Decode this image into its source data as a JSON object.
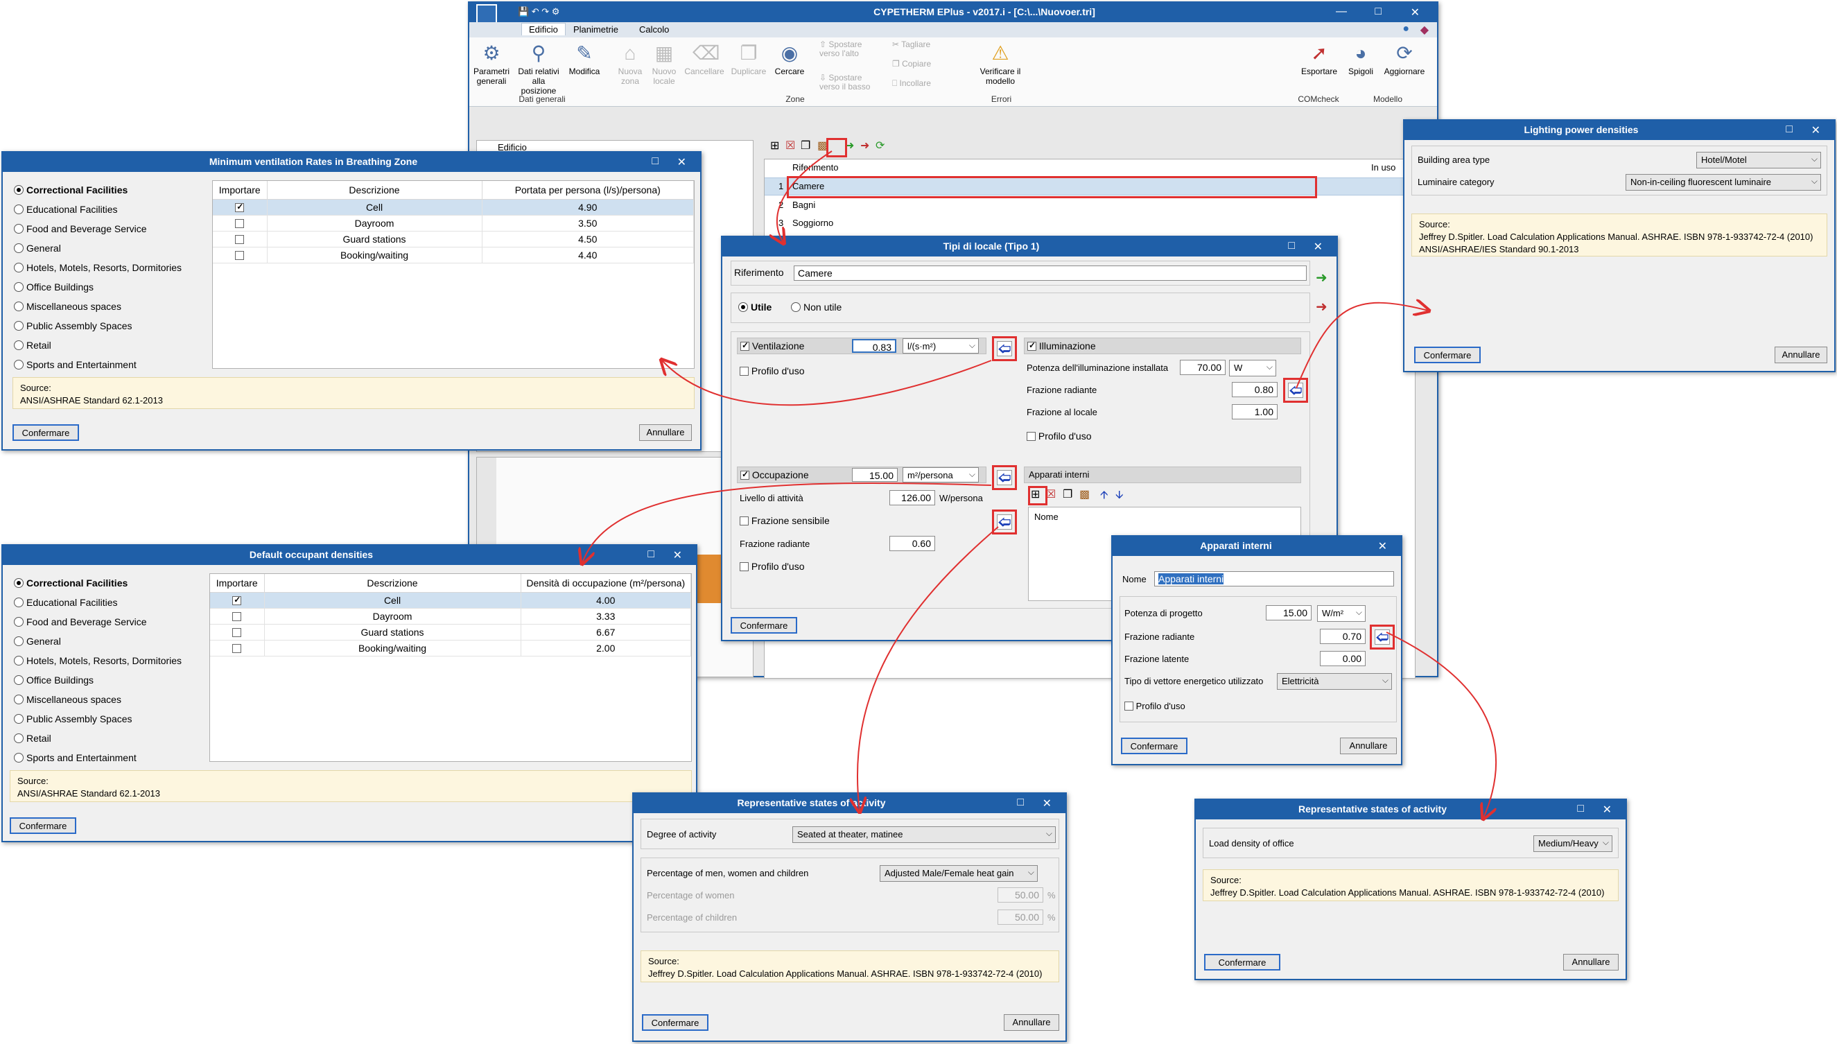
{
  "main_window": {
    "title": "CYPETHERM EPlus - v2017.i - [C:\\...\\Nuovoer.tri]",
    "tabs": [
      "Edificio",
      "Planimetrie",
      "Calcolo"
    ],
    "ribbon": {
      "parametri": "Parametri generali",
      "dati_relativi": "Dati relativi alla posizione",
      "modifica": "Modifica",
      "nuova_zona": "Nuova zona",
      "nuovo_locale": "Nuovo locale",
      "cancellare": "Cancellare",
      "duplicare": "Duplicare",
      "cercare": "Cercare",
      "spostare_alto": "Spostare verso l'alto",
      "spostare_basso": "Spostare verso il basso",
      "tagliare": "Tagliare",
      "copiare": "Copiare",
      "incollare": "Incollare",
      "verificare": "Verificare il modello",
      "esportare": "Esportare",
      "spigoli": "Spigoli",
      "aggiornare": "Aggiornare",
      "groups": [
        "Dati generali",
        "Zone",
        "Errori",
        "COMcheck",
        "Modello"
      ]
    },
    "tree_root": "Edificio",
    "list_headers": [
      "Riferimento",
      "In uso"
    ],
    "list_rows": [
      {
        "n": "1",
        "name": "Camere"
      },
      {
        "n": "2",
        "name": "Bagni"
      },
      {
        "n": "3",
        "name": "Soggiorno"
      }
    ]
  },
  "ventilation_dialog": {
    "title": "Minimum ventilation Rates in Breathing Zone",
    "categories": [
      "Correctional Facilities",
      "Educational Facilities",
      "Food and Beverage Service",
      "General",
      "Hotels, Motels, Resorts, Dormitories",
      "Office Buildings",
      "Miscellaneous spaces",
      "Public Assembly Spaces",
      "Retail",
      "Sports and Entertainment"
    ],
    "headers": [
      "Importare",
      "Descrizione",
      "Portata per persona (l/s)/persona)"
    ],
    "rows": [
      {
        "desc": "Cell",
        "value": "4.90",
        "checked": true
      },
      {
        "desc": "Dayroom",
        "value": "3.50",
        "checked": false
      },
      {
        "desc": "Guard stations",
        "value": "4.50",
        "checked": false
      },
      {
        "desc": "Booking/waiting",
        "value": "4.40",
        "checked": false
      }
    ],
    "source_label": "Source:",
    "source_text": "ANSI/ASHRAE Standard 62.1-2013",
    "confirm": "Confermare",
    "cancel": "Annullare"
  },
  "occupant_dialog": {
    "title": "Default occupant densities",
    "categories": [
      "Correctional Facilities",
      "Educational Facilities",
      "Food and Beverage Service",
      "General",
      "Hotels, Motels, Resorts, Dormitories",
      "Office Buildings",
      "Miscellaneous spaces",
      "Public Assembly Spaces",
      "Retail",
      "Sports and Entertainment"
    ],
    "headers": [
      "Importare",
      "Descrizione",
      "Densità di occupazione (m²/persona)"
    ],
    "rows": [
      {
        "desc": "Cell",
        "value": "4.00",
        "checked": true
      },
      {
        "desc": "Dayroom",
        "value": "3.33",
        "checked": false
      },
      {
        "desc": "Guard stations",
        "value": "6.67",
        "checked": false
      },
      {
        "desc": "Booking/waiting",
        "value": "2.00",
        "checked": false
      }
    ],
    "source_label": "Source:",
    "source_text": "ANSI/ASHRAE Standard 62.1-2013",
    "confirm": "Confermare"
  },
  "tipi_dialog": {
    "title": "Tipi di locale (Tipo 1)",
    "riferimento_label": "Riferimento",
    "riferimento_value": "Camere",
    "utile": "Utile",
    "non_utile": "Non utile",
    "ventilazione": "Ventilazione",
    "ventilazione_value": "0.83",
    "ventilazione_unit": "l/(s·m²)",
    "profilo": "Profilo d'uso",
    "illuminazione": "Illuminazione",
    "potenza_ill_label": "Potenza dell'illuminazione installata",
    "potenza_ill_value": "70.00",
    "potenza_ill_unit": "W",
    "frazione_radiante": "Frazione radiante",
    "frazione_radiante_ill": "0.80",
    "frazione_locale": "Frazione al locale",
    "frazione_locale_value": "1.00",
    "occupazione": "Occupazione",
    "occupazione_value": "15.00",
    "occupazione_unit": "m²/persona",
    "livello_label": "Livello di attività",
    "livello_value": "126.00",
    "livello_unit": "W/persona",
    "frazione_sensibile": "Frazione sensibile",
    "frazione_radiante_occ": "0.60",
    "apparati_interni": "Apparati interni",
    "nome_header": "Nome",
    "confirm": "Confermare"
  },
  "lighting_dialog": {
    "title": "Lighting power densities",
    "building_label": "Building area type",
    "building_value": "Hotel/Motel",
    "luminaire_label": "Luminaire category",
    "luminaire_value": "Non-in-ceiling fluorescent luminaire",
    "source_label": "Source:",
    "source_line1": "Jeffrey D.Spitler. Load Calculation Applications Manual. ASHRAE. ISBN 978-1-933742-72-4 (2010)",
    "source_line2": "ANSI/ASHRAE/IES Standard 90.1-2013",
    "confirm": "Confermare",
    "cancel": "Annullare"
  },
  "apparati_dialog": {
    "title": "Apparati interni",
    "nome_label": "Nome",
    "nome_value": "Apparati interni",
    "potenza_label": "Potenza di progetto",
    "potenza_value": "15.00",
    "potenza_unit": "W/m²",
    "frazione_radiante_label": "Frazione radiante",
    "frazione_radiante_value": "0.70",
    "frazione_latente_label": "Frazione latente",
    "frazione_latente_value": "0.00",
    "vettore_label": "Tipo di vettore energetico utilizzato",
    "vettore_value": "Elettricità",
    "profilo": "Profilo d'uso",
    "confirm": "Confermare",
    "cancel": "Annullare"
  },
  "activity_dialog_1": {
    "title": "Representative states of activity",
    "degree_label": "Degree of activity",
    "degree_value": "Seated at theater, matinee",
    "percentage_label": "Percentage of men, women and children",
    "percentage_value": "Adjusted Male/Female heat gain",
    "women_label": "Percentage of women",
    "women_value": "50.00",
    "children_label": "Percentage of children",
    "children_value": "50.00",
    "pct": "%",
    "source_label": "Source:",
    "source_text": "Jeffrey D.Spitler. Load Calculation Applications Manual. ASHRAE. ISBN 978-1-933742-72-4 (2010)",
    "confirm": "Confermare",
    "cancel": "Annullare"
  },
  "activity_dialog_2": {
    "title": "Representative states of activity",
    "load_label": "Load density of office",
    "load_value": "Medium/Heavy",
    "source_label": "Source:",
    "source_text": "Jeffrey D.Spitler. Load Calculation Applications Manual. ASHRAE. ISBN 978-1-933742-72-4 (2010)",
    "confirm": "Confermare",
    "cancel": "Annullare"
  },
  "colors": {
    "titlebar": "#1f5fa8",
    "highlight": "#e03030",
    "selection": "#cfe0f0",
    "source_bg": "#fdf6df"
  },
  "icons": [
    "arrow-left-icon",
    "close-icon",
    "maximize-icon",
    "checkbox-icon",
    "dropdown-arrow-icon"
  ]
}
